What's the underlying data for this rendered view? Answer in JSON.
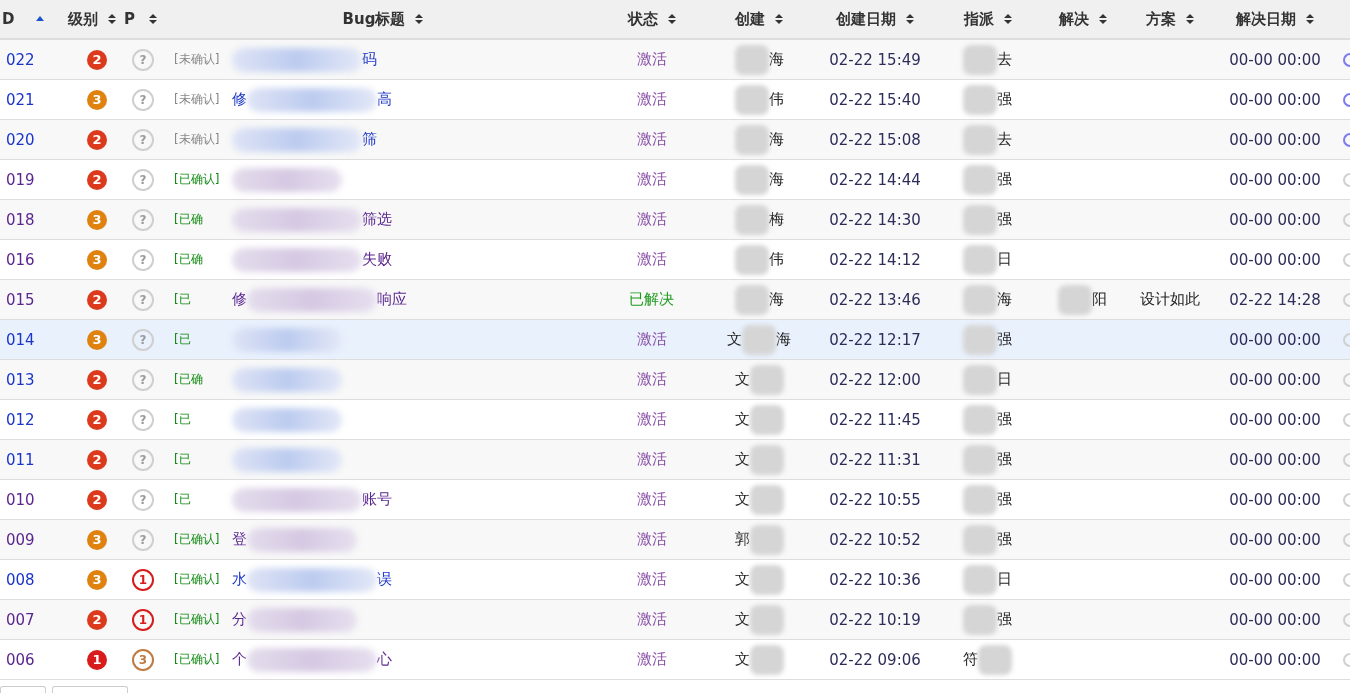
{
  "table": {
    "columns": [
      {
        "label": "D",
        "sorted": true
      },
      {
        "label": "级别",
        "sorted": false
      },
      {
        "label": "P",
        "sorted": false
      },
      {
        "label": "Bug标题",
        "sorted": false
      },
      {
        "label": "状态",
        "sorted": false
      },
      {
        "label": "创建",
        "sorted": false
      },
      {
        "label": "创建日期",
        "sorted": false
      },
      {
        "label": "指派",
        "sorted": false
      },
      {
        "label": "解决",
        "sorted": false
      },
      {
        "label": "方案",
        "sorted": false
      },
      {
        "label": "解决日期",
        "sorted": false
      }
    ],
    "rows": [
      {
        "id": "022",
        "visited": false,
        "selected": false,
        "severity": "2",
        "priority": "?",
        "tag": "[未确认]",
        "confirmed": false,
        "title_head": "",
        "title_tail": "码",
        "status": "激活",
        "resolved": false,
        "creator_head": "",
        "creator_tail": "海",
        "created": "02-22 15:49",
        "assignee_head": "",
        "assignee_tail": "去",
        "resolver_tail": "",
        "solution": "",
        "resolved_date": "00-00 00:00",
        "flag_active": true
      },
      {
        "id": "021",
        "visited": false,
        "selected": false,
        "severity": "3",
        "priority": "?",
        "tag": "[未确认]",
        "confirmed": false,
        "title_head": "修",
        "title_tail": "高",
        "status": "激活",
        "resolved": false,
        "creator_head": "",
        "creator_tail": "伟",
        "created": "02-22 15:40",
        "assignee_head": "",
        "assignee_tail": "强",
        "resolver_tail": "",
        "solution": "",
        "resolved_date": "00-00 00:00",
        "flag_active": true
      },
      {
        "id": "020",
        "visited": false,
        "selected": false,
        "severity": "2",
        "priority": "?",
        "tag": "[未确认]",
        "confirmed": false,
        "title_head": "",
        "title_tail": "筛",
        "status": "激活",
        "resolved": false,
        "creator_head": "",
        "creator_tail": "海",
        "created": "02-22 15:08",
        "assignee_head": "",
        "assignee_tail": "去",
        "resolver_tail": "",
        "solution": "",
        "resolved_date": "00-00 00:00",
        "flag_active": true
      },
      {
        "id": "019",
        "visited": true,
        "selected": false,
        "severity": "2",
        "priority": "?",
        "tag": "[已确认]",
        "confirmed": true,
        "title_head": "",
        "title_tail": "",
        "status": "激活",
        "resolved": false,
        "creator_head": "",
        "creator_tail": "海",
        "created": "02-22 14:44",
        "assignee_head": "",
        "assignee_tail": "强",
        "resolver_tail": "",
        "solution": "",
        "resolved_date": "00-00 00:00",
        "flag_active": false
      },
      {
        "id": "018",
        "visited": true,
        "selected": false,
        "severity": "3",
        "priority": "?",
        "tag": "[已确",
        "confirmed": true,
        "title_head": "",
        "title_tail": "筛选",
        "status": "激活",
        "resolved": false,
        "creator_head": "",
        "creator_tail": "梅",
        "created": "02-22 14:30",
        "assignee_head": "",
        "assignee_tail": "强",
        "resolver_tail": "",
        "solution": "",
        "resolved_date": "00-00 00:00",
        "flag_active": false
      },
      {
        "id": "016",
        "visited": true,
        "selected": false,
        "severity": "3",
        "priority": "?",
        "tag": "[已确",
        "confirmed": true,
        "title_head": "",
        "title_tail": "失败",
        "status": "激活",
        "resolved": false,
        "creator_head": "",
        "creator_tail": "伟",
        "created": "02-22 14:12",
        "assignee_head": "",
        "assignee_tail": "日",
        "resolver_tail": "",
        "solution": "",
        "resolved_date": "00-00 00:00",
        "flag_active": false
      },
      {
        "id": "015",
        "visited": true,
        "selected": false,
        "severity": "2",
        "priority": "?",
        "tag": "[已",
        "confirmed": true,
        "title_head": "修",
        "title_tail": "响应",
        "status": "已解决",
        "resolved": true,
        "creator_head": "",
        "creator_tail": "海",
        "created": "02-22 13:46",
        "assignee_head": "",
        "assignee_tail": "海",
        "resolver_tail": "阳",
        "solution": "设计如此",
        "resolved_date": "02-22 14:28",
        "flag_active": false
      },
      {
        "id": "014",
        "visited": false,
        "selected": true,
        "severity": "3",
        "priority": "?",
        "tag": "[已",
        "confirmed": true,
        "title_head": "",
        "title_tail": "",
        "status": "激活",
        "resolved": false,
        "creator_head": "文",
        "creator_tail": "海",
        "created": "02-22 12:17",
        "assignee_head": "",
        "assignee_tail": "强",
        "resolver_tail": "",
        "solution": "",
        "resolved_date": "00-00 00:00",
        "flag_active": false
      },
      {
        "id": "013",
        "visited": false,
        "selected": false,
        "severity": "2",
        "priority": "?",
        "tag": "[已确",
        "confirmed": true,
        "title_head": "",
        "title_tail": "",
        "status": "激活",
        "resolved": false,
        "creator_head": "文",
        "creator_tail": "",
        "created": "02-22 12:00",
        "assignee_head": "",
        "assignee_tail": "日",
        "resolver_tail": "",
        "solution": "",
        "resolved_date": "00-00 00:00",
        "flag_active": false
      },
      {
        "id": "012",
        "visited": false,
        "selected": false,
        "severity": "2",
        "priority": "?",
        "tag": "[已",
        "confirmed": true,
        "title_head": "",
        "title_tail": "",
        "status": "激活",
        "resolved": false,
        "creator_head": "文",
        "creator_tail": "",
        "created": "02-22 11:45",
        "assignee_head": "",
        "assignee_tail": "强",
        "resolver_tail": "",
        "solution": "",
        "resolved_date": "00-00 00:00",
        "flag_active": false
      },
      {
        "id": "011",
        "visited": false,
        "selected": false,
        "severity": "2",
        "priority": "?",
        "tag": "[已",
        "confirmed": true,
        "title_head": "",
        "title_tail": "",
        "status": "激活",
        "resolved": false,
        "creator_head": "文",
        "creator_tail": "",
        "created": "02-22 11:31",
        "assignee_head": "",
        "assignee_tail": "强",
        "resolver_tail": "",
        "solution": "",
        "resolved_date": "00-00 00:00",
        "flag_active": false
      },
      {
        "id": "010",
        "visited": true,
        "selected": false,
        "severity": "2",
        "priority": "?",
        "tag": "[已",
        "confirmed": true,
        "title_head": "",
        "title_tail": "账号",
        "status": "激活",
        "resolved": false,
        "creator_head": "文",
        "creator_tail": "",
        "created": "02-22 10:55",
        "assignee_head": "",
        "assignee_tail": "强",
        "resolver_tail": "",
        "solution": "",
        "resolved_date": "00-00 00:00",
        "flag_active": false
      },
      {
        "id": "009",
        "visited": true,
        "selected": false,
        "severity": "3",
        "priority": "?",
        "tag": "[已确认]",
        "confirmed": true,
        "title_head": "登",
        "title_tail": "",
        "status": "激活",
        "resolved": false,
        "creator_head": "郭",
        "creator_tail": "",
        "created": "02-22 10:52",
        "assignee_head": "",
        "assignee_tail": "强",
        "resolver_tail": "",
        "solution": "",
        "resolved_date": "00-00 00:00",
        "flag_active": false
      },
      {
        "id": "008",
        "visited": false,
        "selected": false,
        "severity": "3",
        "priority": "1",
        "tag": "[已确认]",
        "confirmed": true,
        "title_head": "水",
        "title_tail": "误",
        "status": "激活",
        "resolved": false,
        "creator_head": "文",
        "creator_tail": "",
        "created": "02-22 10:36",
        "assignee_head": "",
        "assignee_tail": "日",
        "resolver_tail": "",
        "solution": "",
        "resolved_date": "00-00 00:00",
        "flag_active": false
      },
      {
        "id": "007",
        "visited": true,
        "selected": false,
        "severity": "2",
        "priority": "1",
        "tag": "[已确认]",
        "confirmed": true,
        "title_head": "分",
        "title_tail": "",
        "status": "激活",
        "resolved": false,
        "creator_head": "文",
        "creator_tail": "",
        "created": "02-22 10:19",
        "assignee_head": "",
        "assignee_tail": "强",
        "resolver_tail": "",
        "solution": "",
        "resolved_date": "00-00 00:00",
        "flag_active": false
      },
      {
        "id": "006",
        "visited": true,
        "selected": false,
        "severity": "1",
        "priority": "3",
        "tag": "[已确认]",
        "confirmed": true,
        "title_head": "个",
        "title_tail": "心",
        "status": "激活",
        "resolved": false,
        "creator_head": "文",
        "creator_tail": "",
        "created": "02-22 09:06",
        "assignee_head": "符",
        "assignee_tail": "",
        "resolver_tail": "",
        "solution": "",
        "resolved_date": "00-00 00:00",
        "flag_active": false
      }
    ]
  }
}
